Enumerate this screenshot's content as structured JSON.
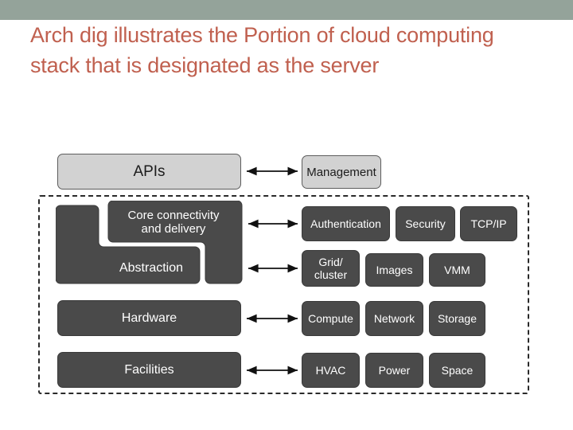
{
  "slide": {
    "title": "Arch dig illustrates the Portion of cloud computing stack that is designated as the server",
    "header_color": "#94a39a",
    "title_color": "#c0604f",
    "background": "#ffffff"
  },
  "diagram": {
    "colors": {
      "light_box_fill": "#d2d2d2",
      "light_box_stroke": "#5d5d5d",
      "dark_box_fill": "#4a4a4a",
      "dark_box_text": "#ffffff",
      "dashed_border": "#2a2a2a",
      "arrow": "#111111"
    },
    "region_label": "server-boundary",
    "left_column": [
      {
        "id": "apis",
        "label": "APIs",
        "style": "light"
      },
      {
        "id": "core-connectivity",
        "label": "Core connectivity\nand delivery",
        "style": "dark"
      },
      {
        "id": "abstraction",
        "label": "Abstraction",
        "style": "dark"
      },
      {
        "id": "hardware",
        "label": "Hardware",
        "style": "dark"
      },
      {
        "id": "facilities",
        "label": "Facilities",
        "style": "dark"
      }
    ],
    "right_column": [
      {
        "id": "management",
        "label": "Management",
        "style": "light"
      },
      {
        "id": "authentication",
        "label": "Authentication",
        "style": "dark"
      },
      {
        "id": "security",
        "label": "Security",
        "style": "dark"
      },
      {
        "id": "tcpip",
        "label": "TCP/IP",
        "style": "dark"
      },
      {
        "id": "grid-cluster",
        "label": "Grid/\ncluster",
        "style": "dark"
      },
      {
        "id": "images",
        "label": "Images",
        "style": "dark"
      },
      {
        "id": "vmm",
        "label": "VMM",
        "style": "dark"
      },
      {
        "id": "compute",
        "label": "Compute",
        "style": "dark"
      },
      {
        "id": "network",
        "label": "Network",
        "style": "dark"
      },
      {
        "id": "storage",
        "label": "Storage",
        "style": "dark"
      },
      {
        "id": "hvac",
        "label": "HVAC",
        "style": "dark"
      },
      {
        "id": "power",
        "label": "Power",
        "style": "dark"
      },
      {
        "id": "space",
        "label": "Space",
        "style": "dark"
      }
    ],
    "connectors": [
      {
        "id": "apis-management",
        "kind": "double-arrow"
      },
      {
        "id": "core-authentication",
        "kind": "double-arrow"
      },
      {
        "id": "abstraction-grid",
        "kind": "double-arrow"
      },
      {
        "id": "hardware-compute",
        "kind": "double-arrow"
      },
      {
        "id": "facilities-hvac",
        "kind": "double-arrow"
      }
    ]
  }
}
